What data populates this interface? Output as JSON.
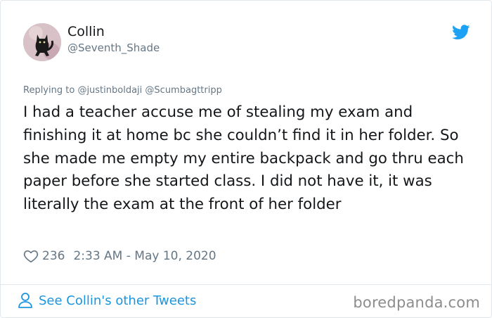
{
  "user": {
    "name": "Collin",
    "handle": "@Seventh_Shade"
  },
  "reply": {
    "prefix": "Replying to",
    "mentions": [
      "@justinboldaji",
      "@Scumbagttripp"
    ]
  },
  "tweet": {
    "text": "I had a teacher accuse me of stealing my exam and finishing it at home bc she couldn’t find it in her folder. So she made me empty my entire backpack and go thru each paper before she started class. I did not have it, it was literally the exam at the front of her folder"
  },
  "meta": {
    "likes": "236",
    "timestamp": "2:33 AM - May 10, 2020"
  },
  "footer": {
    "see_more": "See Collin's other Tweets",
    "watermark": "boredpanda.com"
  },
  "colors": {
    "link": "#1b95e0",
    "secondary_text": "#657786",
    "twitter_blue": "#1da1f2"
  },
  "icons": [
    "avatar",
    "twitter-bird-icon",
    "heart-icon",
    "person-icon"
  ]
}
